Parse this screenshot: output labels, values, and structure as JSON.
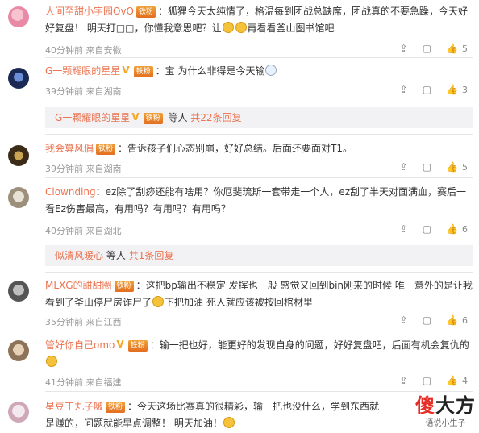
{
  "comments": [
    {
      "username": "人间至甜小字园OvO",
      "badge": "铁粉",
      "text": "狐狸今天太纯情了，格温每到团战总缺席，团战真的不要急躁，今天好好复盘！ 明天打□□，你懂我意思吧？让",
      "text_tail": "再看看釜山图书馆吧",
      "time": "40分钟前",
      "location": "来自安徽",
      "likes": "5"
    },
    {
      "username": "G一颗耀眼的星星",
      "badge": "铁粉",
      "text": "宝 为什么非得是今天输",
      "time": "39分钟前",
      "location": "来自湖南",
      "likes": "3",
      "reply": {
        "username": "G一颗耀眼的星星",
        "text": "等人",
        "link": "共22条回复"
      }
    },
    {
      "username": "我会算风偶",
      "badge": "铁粉",
      "text": "告诉孩子们心态别崩，好好总结。后面还要面对T1。",
      "time": "39分钟前",
      "location": "来自湖南",
      "likes": "5"
    },
    {
      "username": "Clownding",
      "text": "ez除了刮痧还能有啥用？你厄斐琉斯一套带走一个人，ez刮了半天对面满血，赛后一看Ez伤害最高，有用吗？有用吗？有用吗？",
      "time": "40分钟前",
      "location": "来自湖北",
      "likes": "6",
      "reply": {
        "username": "似清风暖心",
        "text": "等人",
        "link": "共1条回复"
      }
    },
    {
      "username": "MLXG的甜甜圈",
      "badge": "铁粉",
      "text": "这把bp输出不稳定 发挥也一般 感觉又回到bin刚来的时候 唯一意外的是让我看到了釜山停尸房诈尸了",
      "text_tail": "下把加油 死人就应该被按回棺材里",
      "time": "35分钟前",
      "location": "来自江西",
      "likes": "6"
    },
    {
      "username": "管好你自己omo",
      "badge": "铁粉",
      "text": "输一把也好，能更好的发现自身的问题，好好复盘吧，后面有机会复仇的",
      "time": "41分钟前",
      "location": "来自福建",
      "likes": "4"
    },
    {
      "username": "星豆丁丸子啵",
      "badge": "铁粉",
      "text": "今天这场比赛真的很精彩，输一把也没什么，学到东西就是赚的，问题就能早点调整！ 明天加油！"
    }
  ],
  "watermark": {
    "line1_red": "傻",
    "line1_black": "大方",
    "line2": "语说小生子"
  },
  "icons": {
    "share": "share-icon",
    "comment": "comment-icon",
    "like": "thumbs-up-icon"
  }
}
